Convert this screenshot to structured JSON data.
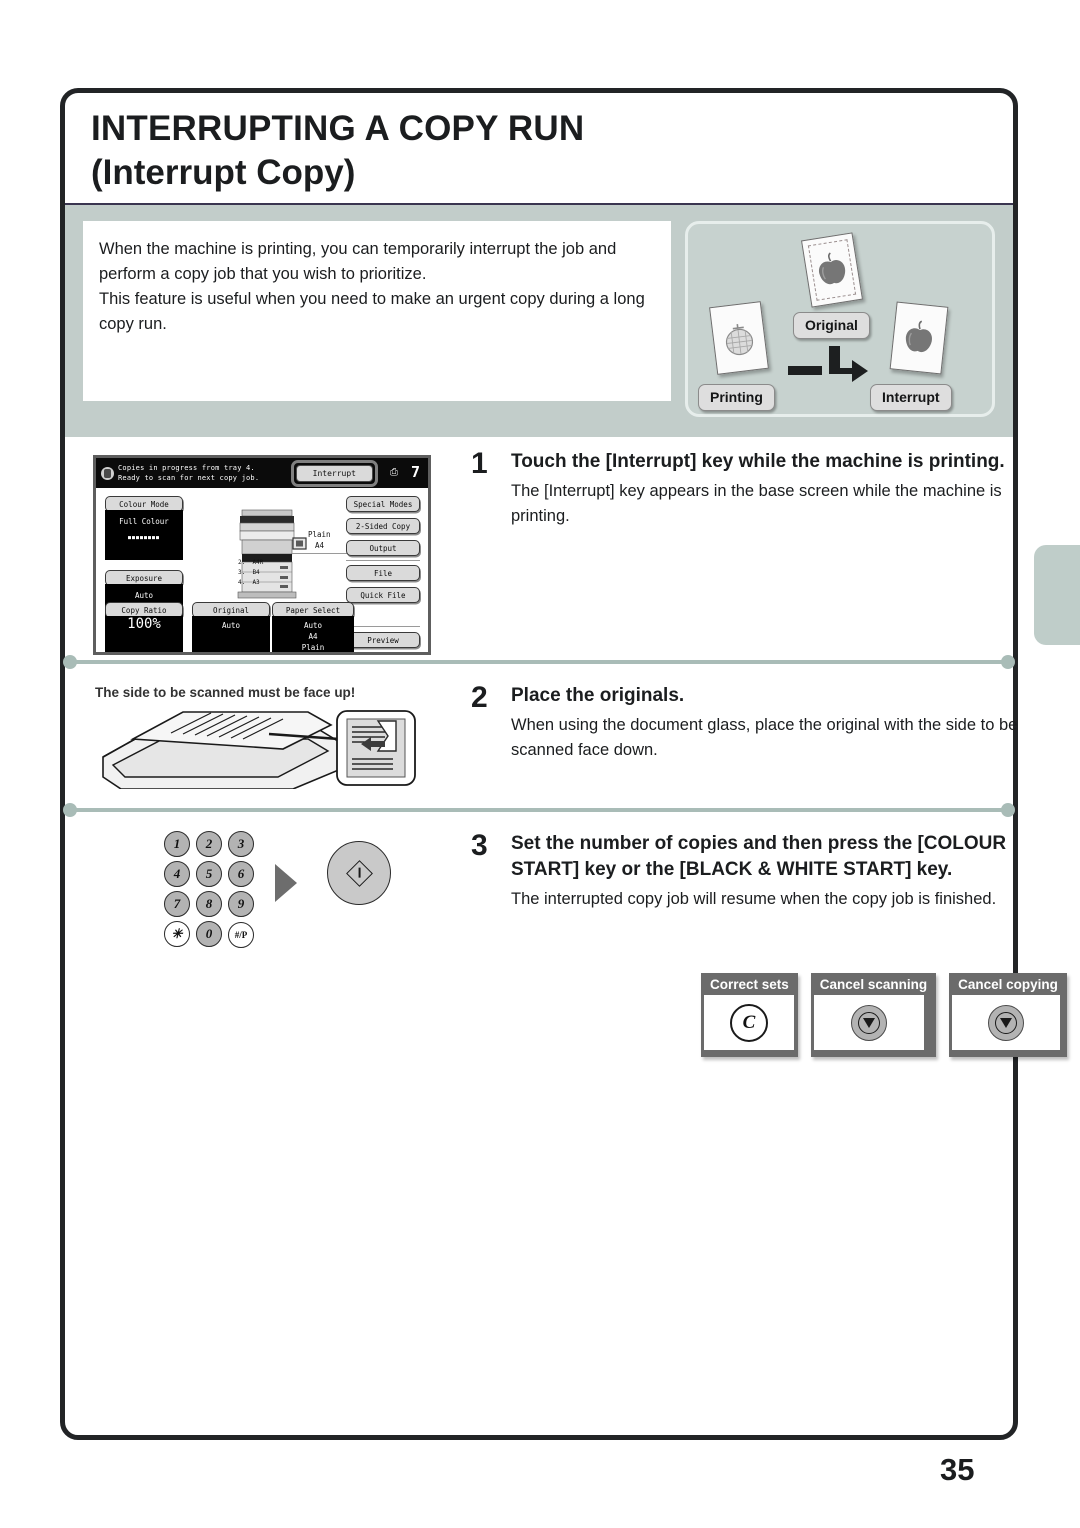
{
  "document": {
    "page_number": "35",
    "title_line1": "INTERRUPTING A COPY RUN",
    "title_line2": "(Interrupt Copy)"
  },
  "intro": {
    "paragraph1": "When the machine is printing, you can temporarily interrupt the job and perform a copy job that you wish to prioritize.",
    "paragraph2": "This feature is useful when you need to make an urgent copy during a long copy run."
  },
  "illustration": {
    "tag_original": "Original",
    "tag_printing": "Printing",
    "tag_interrupt": "Interrupt",
    "icons": {
      "original_sheet": "apple-sheet-icon",
      "printing_sheet": "melon-sheet-icon",
      "interrupt_sheet": "apple-sheet-icon",
      "flow_arrow": "bent-arrow-icon"
    }
  },
  "lcd": {
    "status_line1": "Copies in progress from tray 4.",
    "status_line2": "Ready to scan for next copy job.",
    "status_icon": "printer-status-icon",
    "interrupt_key": "Interrupt",
    "copies_icon": "copies-icon",
    "copies_count": "7",
    "colour_mode": {
      "label": "Colour Mode",
      "value": "Full Colour"
    },
    "exposure": {
      "label": "Exposure",
      "value": "Auto"
    },
    "copy_ratio": {
      "label": "Copy Ratio",
      "value": "100%"
    },
    "original": {
      "label": "Original",
      "value": "Auto"
    },
    "paper_select": {
      "label": "Paper Select",
      "value1": "Auto",
      "value2": "A4",
      "value3": "Plain"
    },
    "paper_callout": {
      "line1": "Plain",
      "line2": "A4"
    },
    "trays": [
      {
        "num": "2.",
        "size": "A4R"
      },
      {
        "num": "3.",
        "size": "B4"
      },
      {
        "num": "4.",
        "size": "A3"
      }
    ],
    "right_buttons": [
      "Special Modes",
      "2-Sided Copy",
      "Output",
      "File",
      "Quick File",
      "Preview"
    ]
  },
  "steps": [
    {
      "number": "1",
      "heading": "Touch the [Interrupt] key while the machine is printing.",
      "body": "The [Interrupt] key appears in the base screen while the machine is printing."
    },
    {
      "number": "2",
      "heading": "Place the originals.",
      "body": "When using the document glass, place the original with the side to be scanned face down.",
      "figure_note": "The side to be scanned must be face up!",
      "figure_icon": "document-feeder-icon"
    },
    {
      "number": "3",
      "heading": "Set the number of copies and then press the [COLOUR START] key or the [BLACK & WHITE START] key.",
      "body": "The interrupted copy job will resume when the copy job is finished.",
      "keypad_keys": [
        "1",
        "2",
        "3",
        "4",
        "5",
        "6",
        "7",
        "8",
        "9",
        "✳",
        "0",
        "#/P"
      ],
      "start_key_icon": "start-key-icon",
      "arrow_icon": "play-arrow-icon"
    }
  ],
  "operation_buttons": [
    {
      "label": "Correct sets",
      "icon": "clear-c-key-icon",
      "glyph": "C"
    },
    {
      "label": "Cancel scanning",
      "icon": "stop-key-icon"
    },
    {
      "label": "Cancel copying",
      "icon": "stop-key-icon"
    }
  ],
  "colors": {
    "band": "#c2cdca",
    "panel": "#c7d2cf",
    "divider": "#a9bcb7",
    "frame": "#222426",
    "opbtn": "#6b6b6b",
    "side_tab": "#bfcdc9"
  }
}
